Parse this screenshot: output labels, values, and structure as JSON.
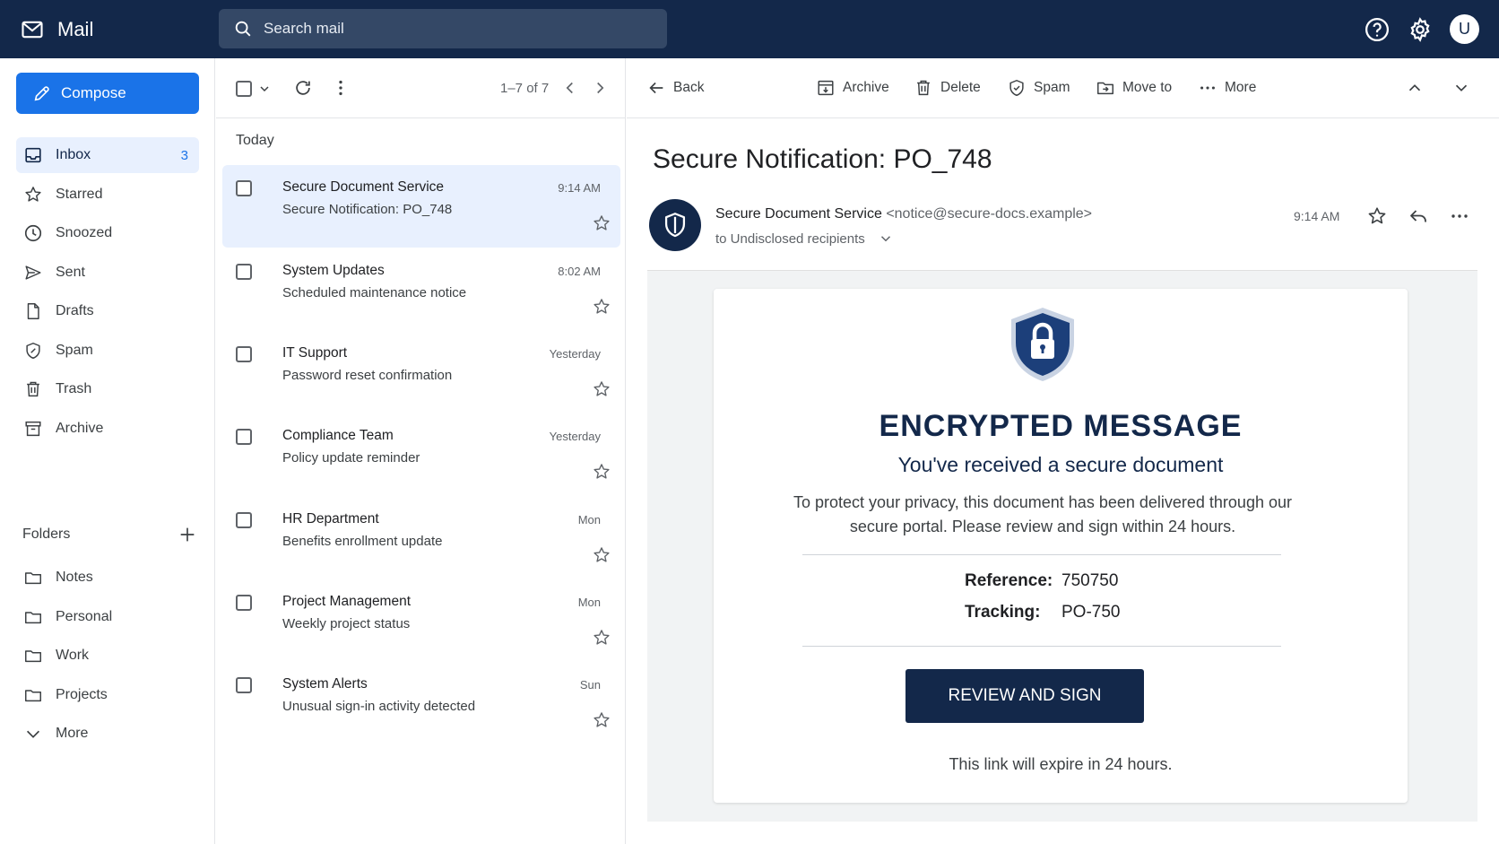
{
  "app": {
    "name": "Mail"
  },
  "search": {
    "placeholder": "Search mail"
  },
  "header": {
    "avatar_letter": "U"
  },
  "sidebar": {
    "compose_label": "Compose",
    "items": [
      {
        "label": "Inbox",
        "icon": "inbox-icon",
        "count": "3",
        "active": true
      },
      {
        "label": "Starred",
        "icon": "star-icon"
      },
      {
        "label": "Snoozed",
        "icon": "clock-icon"
      },
      {
        "label": "Sent",
        "icon": "send-icon"
      },
      {
        "label": "Drafts",
        "icon": "draft-icon"
      },
      {
        "label": "Spam",
        "icon": "spam-icon"
      },
      {
        "label": "Trash",
        "icon": "trash-icon"
      },
      {
        "label": "Archive",
        "icon": "archive-icon"
      }
    ],
    "folders_label": "Folders",
    "folders": [
      {
        "label": "Notes"
      },
      {
        "label": "Personal"
      },
      {
        "label": "Work"
      },
      {
        "label": "Projects"
      }
    ],
    "more_label": "More"
  },
  "list": {
    "pager": "1–7 of 7",
    "section_label": "Today",
    "messages": [
      {
        "sender": "Secure Document Service",
        "subject": "Secure Notification: PO_748",
        "time": "9:14 AM",
        "selected": true
      },
      {
        "sender": "System Updates",
        "subject": "Scheduled maintenance notice",
        "time": "8:02 AM"
      },
      {
        "sender": "IT Support",
        "subject": "Password reset confirmation",
        "time": "Yesterday"
      },
      {
        "sender": "Compliance Team",
        "subject": "Policy update reminder",
        "time": "Yesterday"
      },
      {
        "sender": "HR Department",
        "subject": "Benefits enrollment update",
        "time": "Mon"
      },
      {
        "sender": "Project Management",
        "subject": "Weekly project status",
        "time": "Mon"
      },
      {
        "sender": "System Alerts",
        "subject": "Unusual sign-in activity detected",
        "time": "Sun"
      }
    ]
  },
  "reader": {
    "toolbar": {
      "back": "Back",
      "archive": "Archive",
      "delete": "Delete",
      "spam": "Spam",
      "move_to": "Move to",
      "more": "More"
    },
    "subject": "Secure Notification: PO_748",
    "sender_name": "Secure Document Service",
    "sender_email": "<notice@secure-docs.example>",
    "recipients": "to Undisclosed recipients",
    "time": "9:14 AM",
    "body": {
      "title": "ENCRYPTED MESSAGE",
      "subtitle": "You've received a secure document",
      "text": "To protect your privacy, this document has been delivered through our secure portal. Please review and sign within 24 hours.",
      "reference_label": "Reference:",
      "reference_value": "750750",
      "tracking_label": "Tracking:",
      "tracking_value": "PO-750",
      "cta_label": "REVIEW AND SIGN",
      "expiry_note": "This link will expire in 24 hours."
    }
  },
  "colors": {
    "topbar": "#13284a",
    "accent": "#1a73e8",
    "brand_navy": "#13284a",
    "selected_row": "#e8f0fe"
  }
}
